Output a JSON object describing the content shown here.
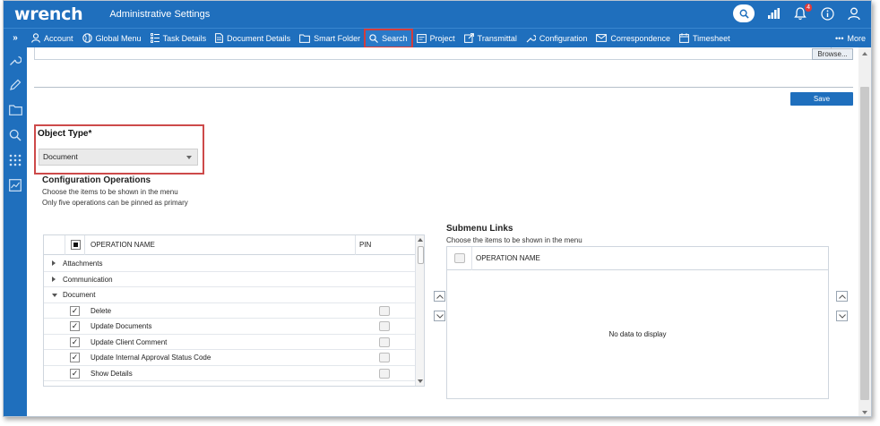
{
  "app": {
    "logo": "wrench",
    "title": "Administrative Settings",
    "notification_count": "4"
  },
  "nav": {
    "expand": "»",
    "items": [
      {
        "label": "Account",
        "icon": "user-icon"
      },
      {
        "label": "Global Menu",
        "icon": "globe-icon"
      },
      {
        "label": "Task Details",
        "icon": "list-icon"
      },
      {
        "label": "Document Details",
        "icon": "document-icon"
      },
      {
        "label": "Smart Folder",
        "icon": "folder-icon"
      },
      {
        "label": "Search",
        "icon": "search-icon",
        "highlighted": true
      },
      {
        "label": "Project",
        "icon": "project-icon"
      },
      {
        "label": "Transmittal",
        "icon": "transmittal-icon"
      },
      {
        "label": "Configuration",
        "icon": "wrench-icon"
      },
      {
        "label": "Correspondence",
        "icon": "envelope-icon"
      },
      {
        "label": "Timesheet",
        "icon": "calendar-icon"
      }
    ],
    "more": "More"
  },
  "toolbar": {
    "browse_label": "Browse...",
    "save_label": "Save"
  },
  "object_type": {
    "label": "Object Type*",
    "value": "Document"
  },
  "config": {
    "title": "Configuration Operations",
    "line1": "Choose the items to be shown in the menu",
    "line2": "Only five operations can be pinned as primary"
  },
  "ops_grid": {
    "col_operation": "OPERATION NAME",
    "col_pin": "PIN",
    "groups": [
      {
        "label": "Attachments",
        "expanded": false
      },
      {
        "label": "Communication",
        "expanded": false
      },
      {
        "label": "Document",
        "expanded": true
      }
    ],
    "rows": [
      {
        "label": "Delete",
        "checked": "✓"
      },
      {
        "label": "Update Documents",
        "checked": "✓"
      },
      {
        "label": "Update Client Comment",
        "checked": "✓"
      },
      {
        "label": "Update Internal Approval Status Code",
        "checked": "✓"
      },
      {
        "label": "Show Details",
        "checked": "✓"
      }
    ]
  },
  "submenu": {
    "title": "Submenu Links",
    "desc": "Choose the items to be shown in the menu",
    "col_operation": "OPERATION NAME",
    "empty_text": "No data to display"
  },
  "colors": {
    "brand": "#1f6fbd",
    "highlight": "#d23c3c"
  }
}
